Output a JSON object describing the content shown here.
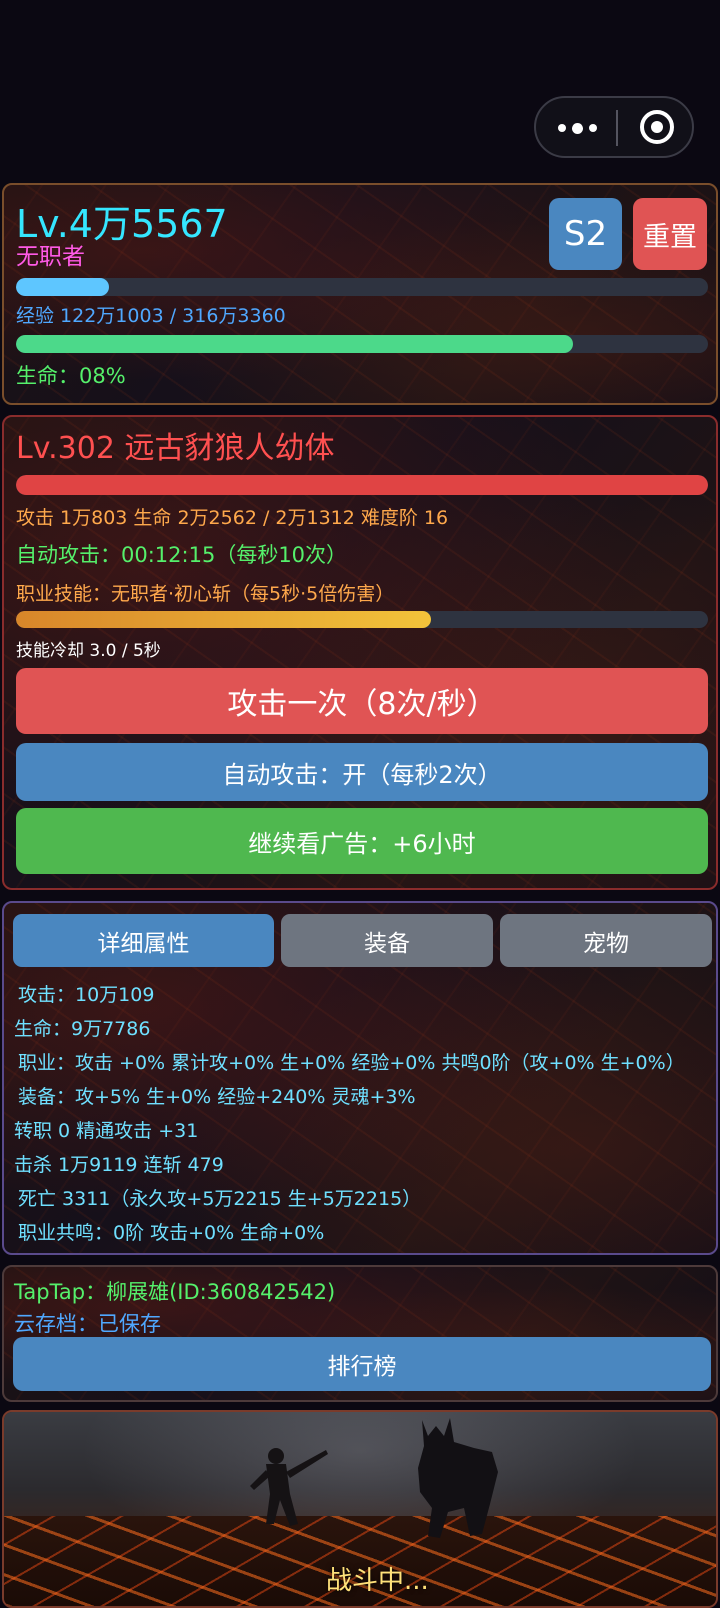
{
  "capsule": {
    "more_icon": "more-dots-icon",
    "close_icon": "target-icon"
  },
  "player": {
    "level": "Lv.4万5567",
    "class": "无职者",
    "season_button": "S2",
    "reset_button": "重置",
    "exp_text": "经验 122万1003 / 316万3360",
    "exp_progress": 0.135,
    "hp_progress": 0.805,
    "hp_text": "生命：08%"
  },
  "monster": {
    "title": "Lv.302  远古豺狼人幼体",
    "hp_progress": 1.0,
    "info_line": "攻击 1万803    生命 2万2562 / 2万1312    难度阶 16",
    "auto_attack_line": "自动攻击：00:12:15（每秒10次）",
    "skill_line": "职业技能：无职者·初心斩（每5秒·5倍伤害）",
    "skill_progress": 0.6,
    "cooldown_text": "技能冷却 3.0 / 5秒",
    "attack_button": "攻击一次（8次/秒）",
    "auto_button": "自动攻击：开（每秒2次）",
    "ad_button": "继续看广告：+6小时"
  },
  "tabs": [
    "详细属性",
    "装备",
    "宠物"
  ],
  "stats": [
    "攻击：10万109",
    "生命：9万7786",
    "职业：攻击 +0%    累计攻+0% 生+0% 经验+0%    共鸣0阶（攻+0% 生+0%）",
    "装备：攻+5% 生+0% 经验+240% 灵魂+3%",
    "转职 0    精通攻击 +31",
    "击杀 1万9119    连斩 479",
    "死亡 3311（永久攻+5万2215 生+5万2215）",
    "职业共鸣：0阶    攻击+0% 生命+0%"
  ],
  "account": {
    "taptap": "TapTap：柳展雄(ID:360842542)",
    "cloud_save": "云存档：已保存",
    "leaderboard_button": "排行榜"
  },
  "battle": {
    "status": "战斗中..."
  },
  "colors": {
    "level_cyan": "#35e6ff",
    "class_magenta": "#ff5ae6",
    "season_blue": "#4a87c0",
    "reset_red": "#e05454",
    "exp_bar": "#5ec6ff",
    "hp_bar": "#4cd98a",
    "monster_red": "#ff5050",
    "info_orange": "#ffa94c",
    "auto_green": "#55f06b",
    "skill_bar": "#f2b53a",
    "button_red": "#e05454",
    "button_blue": "#4a87c0",
    "button_green": "#4fb84f",
    "tab_active": "#4a87c0",
    "tab_inactive": "#6e7580"
  }
}
